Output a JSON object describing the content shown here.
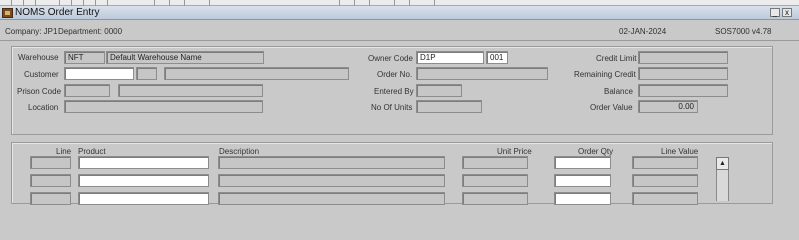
{
  "window": {
    "title": "NOMS Order Entry",
    "minimize_glyph": "_",
    "close_glyph": "x"
  },
  "info": {
    "company": "Company: JP1",
    "department": "Department: 0000",
    "date": "02-JAN-2024",
    "version": "SOS7000  v4.78"
  },
  "header": {
    "warehouse_label": "Warehouse",
    "warehouse_code": "NFT",
    "warehouse_name": "Default Warehouse Name",
    "customer_label": "Customer",
    "prison_code_label": "Prison Code",
    "location_label": "Location",
    "owner_code_label": "Owner Code",
    "owner_code": "D1P",
    "owner_code_2": "001",
    "order_no_label": "Order No.",
    "entered_by_label": "Entered By",
    "no_of_units_label": "No Of Units",
    "credit_limit_label": "Credit Limit",
    "remaining_credit_label": "Remaining Credit",
    "balance_label": "Balance",
    "order_value_label": "Order Value",
    "order_value": "0.00"
  },
  "lines": {
    "columns": {
      "line": "Line",
      "product": "Product",
      "description": "Description",
      "unit_price": "Unit Price",
      "order_qty": "Order Qty",
      "line_value": "Line Value"
    },
    "scroll_up_glyph": "▲"
  }
}
